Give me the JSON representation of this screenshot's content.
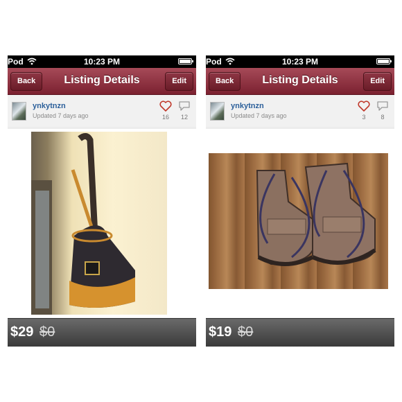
{
  "colors": {
    "navbar": "#8e2f3c",
    "username": "#2b5f9a",
    "heart": "#c0392b",
    "price_bar": "#4a4a4a"
  },
  "screens": [
    {
      "status": {
        "carrier": "Pod",
        "time": "10:23 PM"
      },
      "nav": {
        "back_label": "Back",
        "title": "Listing Details",
        "edit_label": "Edit"
      },
      "user": {
        "name": "ynkytnzn",
        "updated": "Updated 7 days ago"
      },
      "stats": {
        "likes": "16",
        "comments": "12",
        "like_icon": "heart-icon",
        "comment_icon": "speech-bubble-icon"
      },
      "photo": {
        "subject": ""
      },
      "price": {
        "current": "$29",
        "original": "$0"
      }
    },
    {
      "status": {
        "carrier": "Pod",
        "time": "10:23 PM"
      },
      "nav": {
        "back_label": "Back",
        "title": "Listing Details",
        "edit_label": "Edit"
      },
      "user": {
        "name": "ynkytnzn",
        "updated": "Updated 7 days ago"
      },
      "stats": {
        "likes": "3",
        "comments": "8",
        "like_icon": "heart-icon",
        "comment_icon": "speech-bubble-icon"
      },
      "photo": {
        "subject": ""
      },
      "price": {
        "current": "$19",
        "original": "$0"
      }
    }
  ]
}
